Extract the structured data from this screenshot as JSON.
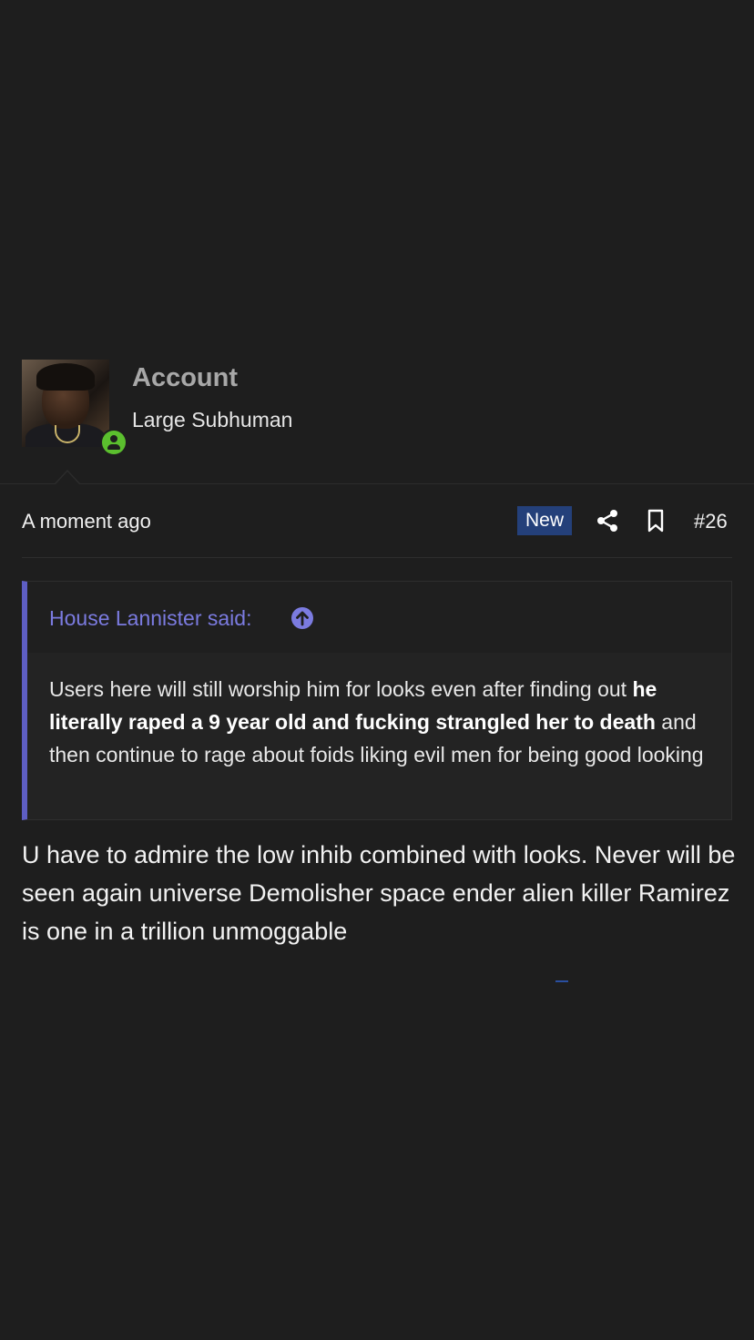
{
  "user": {
    "name": "Account",
    "title": "Large Subhuman",
    "avatar_icon": "avatar-photo",
    "status_icon": "online-user-icon",
    "status_color": "#5bbf2e"
  },
  "post_meta": {
    "timestamp": "A moment ago",
    "new_label": "New",
    "new_badge_color": "#24407a",
    "share_icon": "share-icon",
    "bookmark_icon": "bookmark-icon",
    "post_number": "#26"
  },
  "quote": {
    "author_line": "House Lannister said:",
    "jump_icon": "arrow-up-circle-icon",
    "accent_color": "#5e5ec4",
    "text_part1": "Users here will still worship him for looks even after finding out ",
    "text_bold": "he literally raped a 9 year old and fucking strangled her to death",
    "text_part2": " and then continue to rage about foids liking evil men for being good looking"
  },
  "post": {
    "body": "U have to admire the low inhib combined with looks. Never will be seen again universe Demolisher space ender alien killer Ramirez is one in a trillion unmoggable"
  }
}
